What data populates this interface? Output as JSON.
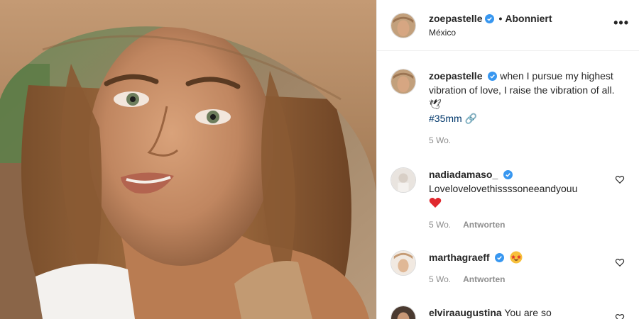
{
  "post": {
    "username": "zoepastelle",
    "follow_state": "Abonniert",
    "location": "México",
    "separator": "•",
    "more_label": "•••"
  },
  "caption": {
    "username": "zoepastelle",
    "text": "when I pursue my highest vibration of love, I raise the vibration of all. 🕊",
    "hashtag": "#35mm",
    "hashtag_suffix": "🔗",
    "age": "5 Wo."
  },
  "comments": [
    {
      "username": "nadiadamaso_",
      "verified": true,
      "text": "Lovelovelovethissssoneeandyouu",
      "age": "5 Wo.",
      "reply": "Antworten",
      "emoji": "red-heart"
    },
    {
      "username": "marthagraeff",
      "verified": true,
      "text": "",
      "age": "5 Wo.",
      "reply": "Antworten",
      "emoji": "star-struck"
    },
    {
      "username": "elviraaugustina",
      "verified": false,
      "text": "You are so",
      "age": "",
      "reply": ""
    }
  ],
  "colors": {
    "verified_blue": "#3897f0",
    "hashtag": "#00376b",
    "muted": "#8e8e8e",
    "heart_red": "#ed4956"
  }
}
